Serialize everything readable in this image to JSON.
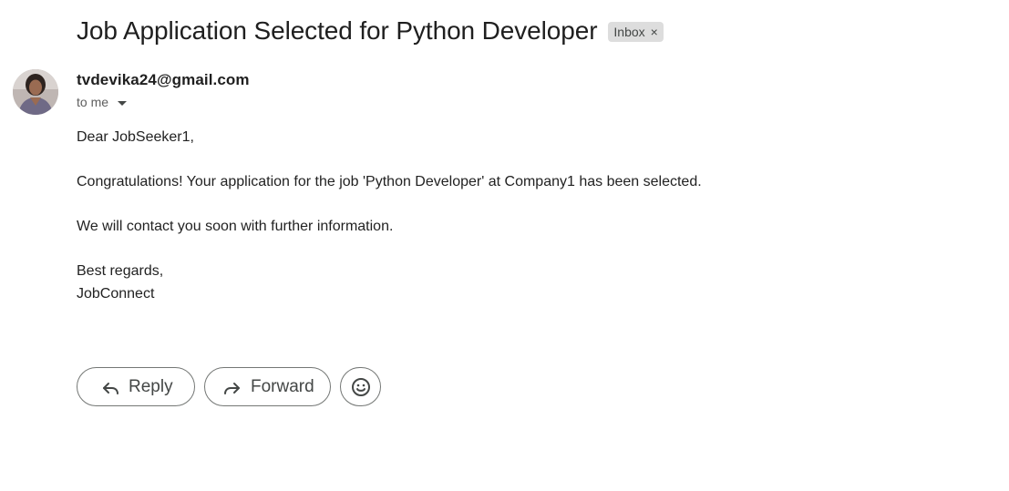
{
  "email": {
    "subject": "Job Application Selected for Python Developer",
    "label": "Inbox",
    "label_remove": "×",
    "sender": "tvdevika24@gmail.com",
    "recipient": "to me",
    "body": {
      "greeting": "Dear JobSeeker1,",
      "line1": "Congratulations! Your application for the job 'Python Developer' at Company1 has been selected.",
      "line2": "We will contact you soon with further information.",
      "signoff": "Best regards,",
      "signature": "JobConnect"
    }
  },
  "actions": {
    "reply_label": "Reply",
    "forward_label": "Forward",
    "reply_icon": "reply-icon",
    "forward_icon": "forward-icon",
    "emoji_icon": "emoji-reaction-icon"
  },
  "colors": {
    "label_bg": "#dddddd",
    "text": "#1f1f1f",
    "button_border": "#747775"
  }
}
